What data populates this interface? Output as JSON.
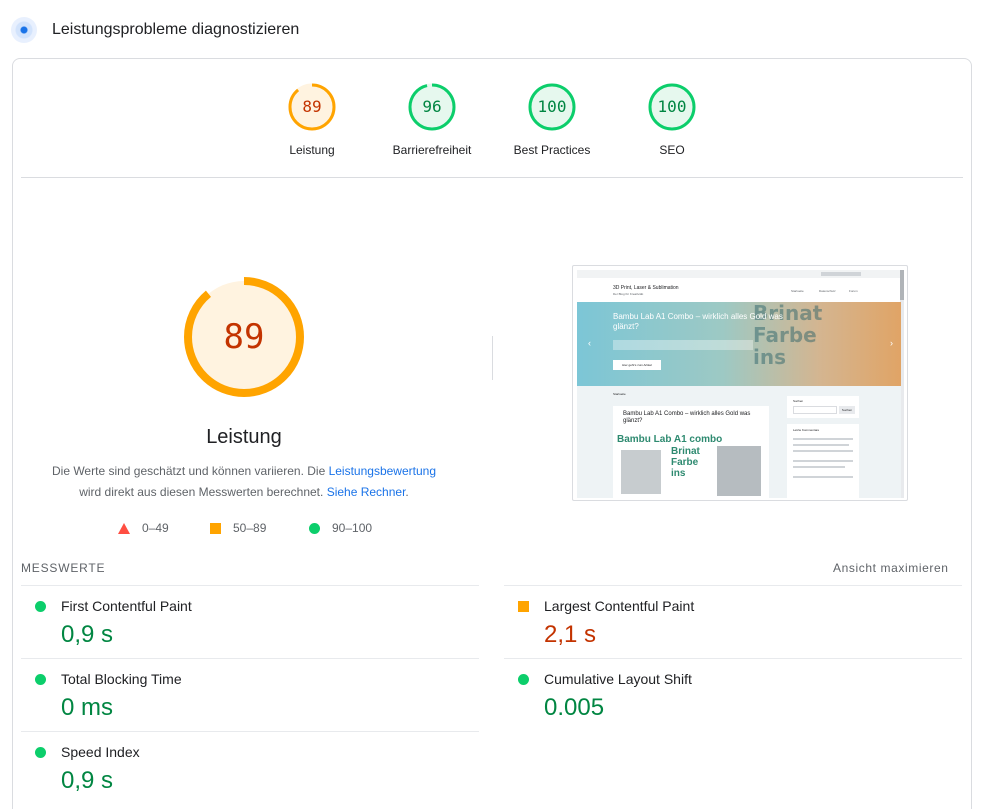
{
  "header": {
    "title": "Leistungsprobleme diagnostizieren"
  },
  "scores": [
    {
      "value": 89,
      "label": "Leistung",
      "status": "average"
    },
    {
      "value": 96,
      "label": "Barrierefreiheit",
      "status": "pass"
    },
    {
      "value": 100,
      "label": "Best Practices",
      "status": "pass"
    },
    {
      "value": 100,
      "label": "SEO",
      "status": "pass"
    }
  ],
  "main": {
    "score": 89,
    "title": "Leistung",
    "desc_part1": "Die Werte sind geschätzt und können variieren. Die ",
    "desc_link1": "Leistungsbewertung",
    "desc_part2": "wird direkt aus diesen Messwerten berechnet.",
    "desc_link2": "Siehe Rechner",
    "desc_end": "."
  },
  "legend": [
    {
      "shape": "triangle",
      "range": "0–49"
    },
    {
      "shape": "square",
      "range": "50–89"
    },
    {
      "shape": "circle",
      "range": "90–100"
    }
  ],
  "screenshot": {
    "site_title": "3D Print, Laser & Sublimation",
    "site_tagline": "Der Blog für Kreativität",
    "nav": [
      "Startseite",
      "Datenschutz",
      "Forum"
    ],
    "hero_title": "Bambu Lab A1 Combo – wirklich alles Gold was glänzt?",
    "hero_overlay": [
      "Brinat",
      "Farbe",
      "ins"
    ],
    "hero_button": "Hier geht's zum Artikel",
    "section_label": "Startseite",
    "post_title": "Bambu Lab A1 Combo – wirklich alles Gold was glänzt?",
    "post_image_text": [
      "Bambu Lab A1 combo",
      "Brinat",
      "Farbe",
      "ins"
    ],
    "sidebar_search_label": "Suchen",
    "sidebar_search_button": "Suchen",
    "sidebar_comments": "Letzte Kommentare"
  },
  "metrics": {
    "section_title": "MESSWERTE",
    "expand_label": "Ansicht maximieren",
    "items": [
      {
        "name": "First Contentful Paint",
        "value": "0,9 s",
        "status": "pass"
      },
      {
        "name": "Largest Contentful Paint",
        "value": "2,1 s",
        "status": "average"
      },
      {
        "name": "Total Blocking Time",
        "value": "0 ms",
        "status": "pass"
      },
      {
        "name": "Cumulative Layout Shift",
        "value": "0.005",
        "status": "pass"
      },
      {
        "name": "Speed Index",
        "value": "0,9 s",
        "status": "pass"
      }
    ]
  },
  "colors": {
    "pass": "#0cce6b",
    "average": "#ffa400",
    "fail": "#ff4e42",
    "link": "#1a73e8"
  }
}
